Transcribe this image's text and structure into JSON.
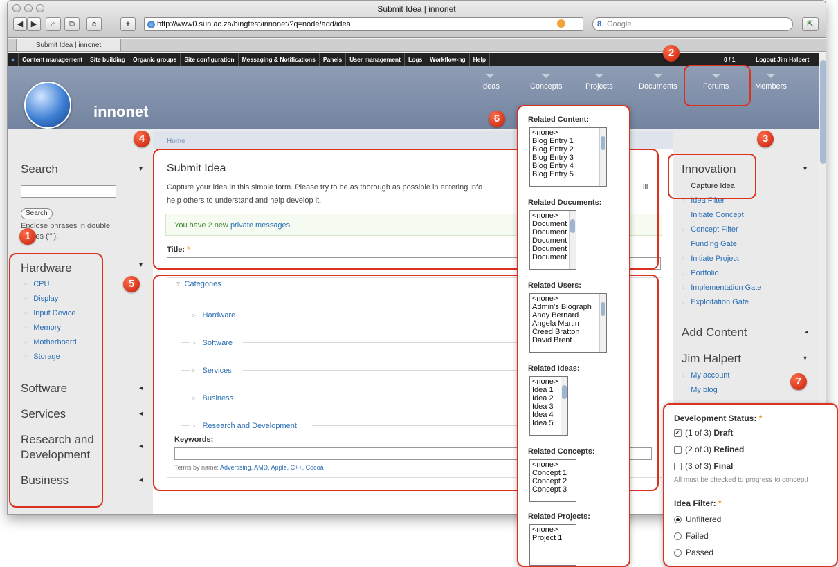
{
  "window": {
    "title": "Submit Idea | innonet"
  },
  "toolbar": {
    "url": "http://www0.sun.ac.za/bingtest/innonet/?q=node/add/idea",
    "search_placeholder": "Google",
    "back": "◀",
    "forward": "▶",
    "home": "⌂",
    "reload": "c",
    "add": "+"
  },
  "tab": {
    "label": "Submit Idea | innonet"
  },
  "admin": {
    "items": [
      "Content management",
      "Site building",
      "Organic groups",
      "Site configuration",
      "Messaging & Notifications",
      "Panels",
      "User management",
      "Logs",
      "Workflow-ng",
      "Help"
    ],
    "counter": "0 / 1",
    "logout": "Logout Jim Halpert"
  },
  "site": {
    "name": "innonet",
    "nav": [
      "Ideas",
      "Concepts",
      "Projects",
      "Documents",
      "Forums",
      "Members"
    ]
  },
  "breadcrumb": "Home",
  "left": {
    "search_title": "Search",
    "search_button": "Search",
    "search_hint_1": "Enclose phrases in double",
    "search_hint_2": "quotes (\"\").",
    "hardware_title": "Hardware",
    "hardware_items": [
      "CPU",
      "Display",
      "Input Device",
      "Memory",
      "Motherboard",
      "Storage"
    ],
    "software": "Software",
    "services": "Services",
    "rnd_1": "Research and",
    "rnd_2": "Development",
    "business": "Business"
  },
  "form": {
    "title": "Submit Idea",
    "desc_1": "Capture your idea in this simple form. Please try to be as thorough as possible in entering info",
    "desc_1b": "ill",
    "desc_2": "help others to understand and help develop it.",
    "msg_pre": "You have 2 new ",
    "msg_link": "private messages",
    "msg_post": ".",
    "title_label": "Title:",
    "required": "*",
    "categories": "Categories",
    "category_items": [
      "Hardware",
      "Software",
      "Services",
      "Business",
      "Research and Development"
    ],
    "keywords_label": "Keywords:",
    "terms_prefix": "Terms by name:",
    "terms": "Advertising, AMD, Apple, C++, Cocoa"
  },
  "related": {
    "content_label": "Related Content:",
    "content": [
      "<none>",
      "Blog Entry 1",
      "Blog Entry 2",
      "Blog Entry 3",
      "Blog Entry 4",
      "Blog Entry 5"
    ],
    "documents_label": "Related Documents:",
    "documents": [
      "<none>",
      "Document",
      "Document",
      "Document",
      "Document",
      "Document"
    ],
    "users_label": "Related Users:",
    "users": [
      "<none>",
      "Admin's Biograph",
      "Andy Bernard",
      "Angela Martin",
      "Creed Bratton",
      "David Brent"
    ],
    "ideas_label": "Related Ideas:",
    "ideas": [
      "<none>",
      "Idea 1",
      "Idea 2",
      "Idea 3",
      "Idea 4",
      "Idea 5"
    ],
    "concepts_label": "Related Concepts:",
    "concepts": [
      "<none>",
      "Concept 1",
      "Concept 2",
      "Concept 3"
    ],
    "projects_label": "Related Projects:",
    "projects": [
      "<none>",
      "Project 1"
    ]
  },
  "right": {
    "innovation_title": "Innovation",
    "innovation_items": [
      "Capture Idea",
      "Idea Filter",
      "Initiate Concept",
      "Concept Filter",
      "Funding Gate",
      "Initiate Project",
      "Portfolio",
      "Implementation Gate",
      "Exploitation Gate"
    ],
    "add_content": "Add Content",
    "user_title": "Jim Halpert",
    "user_items": [
      "My account",
      "My blog"
    ]
  },
  "status": {
    "label": "Development Status:",
    "opt1_pre": "(1 of 3) ",
    "opt1": "Draft",
    "opt2_pre": "(2 of 3) ",
    "opt2": "Refined",
    "opt3_pre": "(3 of 3) ",
    "opt3": "Final",
    "checked": "✓",
    "hint": "All must be checked to progress to concept!",
    "filter_label": "Idea Filter:",
    "filter_options": [
      "Unfiltered",
      "Failed",
      "Passed"
    ]
  },
  "badges": [
    "1",
    "2",
    "3",
    "4",
    "5",
    "6",
    "7"
  ],
  "colors": {
    "highlight": "#d9331f",
    "link": "#2b6fb3",
    "header": "#7f8ea8"
  }
}
